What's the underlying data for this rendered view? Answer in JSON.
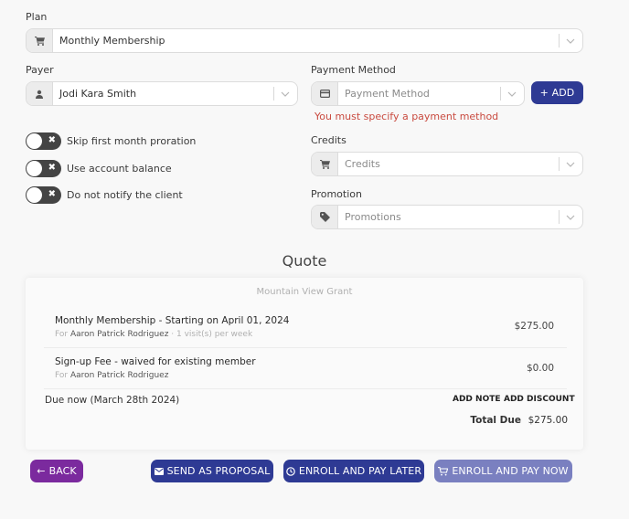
{
  "plan": {
    "label": "Plan",
    "icon": "cart-icon",
    "value": "Monthly Membership"
  },
  "payer": {
    "label": "Payer",
    "icon": "user-icon",
    "value": "Jodi Kara Smith"
  },
  "payment_method": {
    "label": "Payment Method",
    "icon": "credit-card-icon",
    "placeholder": "Payment Method",
    "add_button": "+ ADD",
    "error": "You must specify a payment method"
  },
  "credits": {
    "label": "Credits",
    "icon": "cart-icon",
    "placeholder": "Credits"
  },
  "promotion": {
    "label": "Promotion",
    "icon": "tag-icon",
    "placeholder": "Promotions"
  },
  "toggles": [
    {
      "label": "Skip first month proration",
      "on": false
    },
    {
      "label": "Use account balance",
      "on": false
    },
    {
      "label": "Do not notify the client",
      "on": false
    }
  ],
  "quote": {
    "title": "Quote",
    "location": "Mountain View Grant",
    "items": [
      {
        "title": "Monthly Membership - Starting on April 01, 2024",
        "for_prefix": "For",
        "for_name": "Aaron Patrick Rodriguez",
        "detail": " · 1 visit(s) per week",
        "price": "$275.00"
      },
      {
        "title": "Sign-up Fee - waived for existing member",
        "for_prefix": "For",
        "for_name": "Aaron Patrick Rodriguez",
        "detail": "",
        "price": "$0.00"
      }
    ],
    "due_now": "Due now (March 28th 2024)",
    "add_note": "ADD NOTE",
    "add_discount": "ADD DISCOUNT",
    "total_label": "Total Due",
    "total_value": "$275.00"
  },
  "actions": {
    "back": "BACK",
    "send_proposal": "SEND AS PROPOSAL",
    "enroll_pay_later": "ENROLL AND PAY LATER",
    "enroll_pay_now": "ENROLL AND PAY NOW"
  },
  "colors": {
    "primary": "#2e3a94",
    "primary_disabled": "#7a80c0",
    "back": "#7b2a9e",
    "error": "#c94a3f"
  }
}
